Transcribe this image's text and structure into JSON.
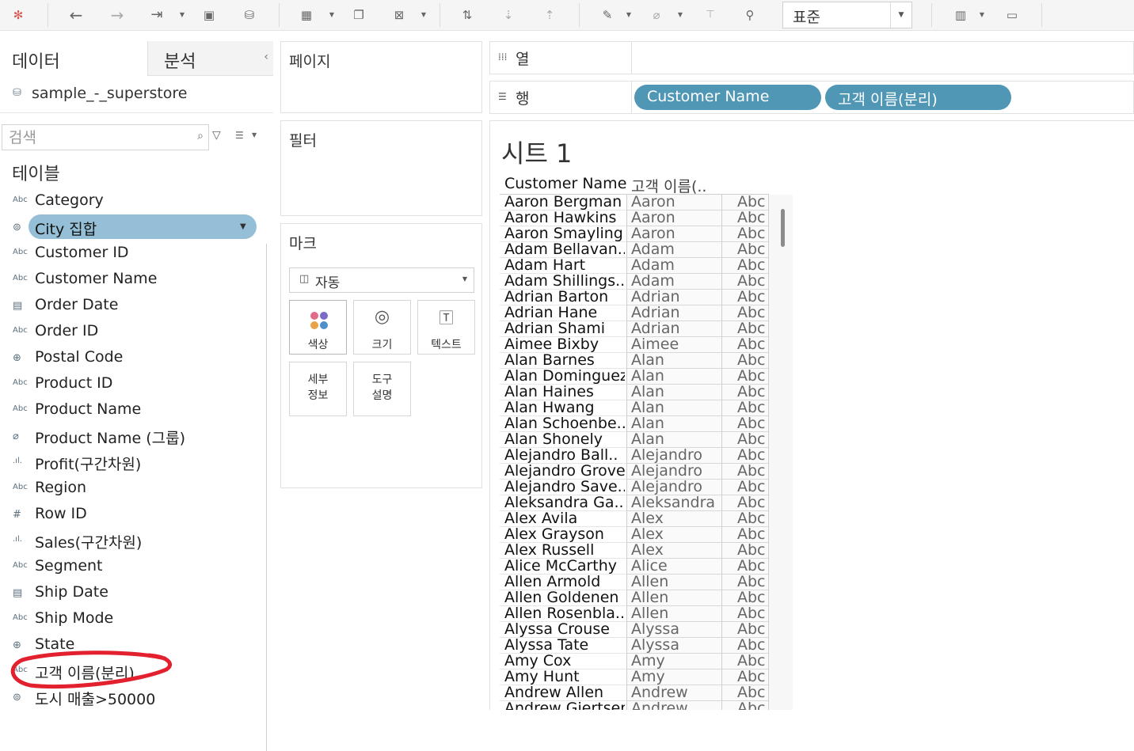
{
  "toolbar": {
    "view_select": "표준",
    "icons": [
      "tableau-logo-icon",
      "undo-icon",
      "redo-icon",
      "replay-icon",
      "save-icon",
      "new-datasource-icon",
      "new-worksheet-icon",
      "duplicate-icon",
      "clear-icon",
      "swap-icon",
      "sort-asc-icon",
      "sort-desc-icon",
      "highlight-icon",
      "group-icon",
      "label-icon",
      "pin-icon",
      "show-me-icon",
      "presentation-icon"
    ]
  },
  "left": {
    "tab_data": "데이터",
    "tab_analysis": "분석",
    "collapse": "‹",
    "datasource": "sample_-_superstore",
    "search_placeholder": "검색",
    "tables_title": "테이블",
    "fields": [
      {
        "name": "Category",
        "icon": "Abc"
      },
      {
        "name": "City 집합",
        "icon": "set"
      },
      {
        "name": "Customer ID",
        "icon": "Abc"
      },
      {
        "name": "Customer Name",
        "icon": "Abc"
      },
      {
        "name": "Order Date",
        "icon": "date"
      },
      {
        "name": "Order ID",
        "icon": "Abc"
      },
      {
        "name": "Postal Code",
        "icon": "geo"
      },
      {
        "name": "Product ID",
        "icon": "Abc"
      },
      {
        "name": "Product Name",
        "icon": "Abc"
      },
      {
        "name": "Product Name (그룹)",
        "icon": "group"
      },
      {
        "name": "Profit(구간차원)",
        "icon": "bin"
      },
      {
        "name": "Region",
        "icon": "Abc"
      },
      {
        "name": "Row ID",
        "icon": "#"
      },
      {
        "name": "Sales(구간차원)",
        "icon": "bin"
      },
      {
        "name": "Segment",
        "icon": "Abc"
      },
      {
        "name": "Ship Date",
        "icon": "date"
      },
      {
        "name": "Ship Mode",
        "icon": "Abc"
      },
      {
        "name": "State",
        "icon": "geo"
      },
      {
        "name": "고객 이름(분리)",
        "icon": "Abc"
      },
      {
        "name": "도시 매출>50000",
        "icon": "set"
      }
    ]
  },
  "cards": {
    "pages": "페이지",
    "filters": "필터",
    "marks": "마크",
    "mark_type": "자동",
    "buttons": {
      "color": "색상",
      "size": "크기",
      "text": "텍스트",
      "detail_1": "세부",
      "detail_2": "정보",
      "tooltip_1": "도구",
      "tooltip_2": "설명"
    }
  },
  "shelves": {
    "columns_label": "열",
    "rows_label": "행",
    "rows_pills": [
      "Customer Name",
      "고객 이름(분리)"
    ]
  },
  "sheet": {
    "title": "시트 1",
    "headers": [
      "Customer Name",
      "고객 이름(.."
    ],
    "rows": [
      [
        "Aaron Bergman",
        "Aaron",
        "Abc"
      ],
      [
        "Aaron Hawkins",
        "Aaron",
        "Abc"
      ],
      [
        "Aaron Smayling",
        "Aaron",
        "Abc"
      ],
      [
        "Adam Bellavan..",
        "Adam",
        "Abc"
      ],
      [
        "Adam Hart",
        "Adam",
        "Abc"
      ],
      [
        "Adam Shillings..",
        "Adam",
        "Abc"
      ],
      [
        "Adrian Barton",
        "Adrian",
        "Abc"
      ],
      [
        "Adrian Hane",
        "Adrian",
        "Abc"
      ],
      [
        "Adrian Shami",
        "Adrian",
        "Abc"
      ],
      [
        "Aimee Bixby",
        "Aimee",
        "Abc"
      ],
      [
        "Alan Barnes",
        "Alan",
        "Abc"
      ],
      [
        "Alan Dominguez",
        "Alan",
        "Abc"
      ],
      [
        "Alan Haines",
        "Alan",
        "Abc"
      ],
      [
        "Alan Hwang",
        "Alan",
        "Abc"
      ],
      [
        "Alan Schoenbe..",
        "Alan",
        "Abc"
      ],
      [
        "Alan Shonely",
        "Alan",
        "Abc"
      ],
      [
        "Alejandro Ball..",
        "Alejandro",
        "Abc"
      ],
      [
        "Alejandro Grove",
        "Alejandro",
        "Abc"
      ],
      [
        "Alejandro Save..",
        "Alejandro",
        "Abc"
      ],
      [
        "Aleksandra Ga..",
        "Aleksandra",
        "Abc"
      ],
      [
        "Alex Avila",
        "Alex",
        "Abc"
      ],
      [
        "Alex Grayson",
        "Alex",
        "Abc"
      ],
      [
        "Alex Russell",
        "Alex",
        "Abc"
      ],
      [
        "Alice McCarthy",
        "Alice",
        "Abc"
      ],
      [
        "Allen Armold",
        "Allen",
        "Abc"
      ],
      [
        "Allen Goldenen",
        "Allen",
        "Abc"
      ],
      [
        "Allen Rosenbla..",
        "Allen",
        "Abc"
      ],
      [
        "Alyssa Crouse",
        "Alyssa",
        "Abc"
      ],
      [
        "Alyssa Tate",
        "Alyssa",
        "Abc"
      ],
      [
        "Amy Cox",
        "Amy",
        "Abc"
      ],
      [
        "Amy Hunt",
        "Amy",
        "Abc"
      ],
      [
        "Andrew Allen",
        "Andrew",
        "Abc"
      ],
      [
        "Andrew Gjertsen",
        "Andrew",
        "Abc"
      ]
    ]
  },
  "colors": {
    "selected_pill": "#94bfd6",
    "shelf_pill": "#4f97b4",
    "annotation_red": "#e3202e"
  }
}
